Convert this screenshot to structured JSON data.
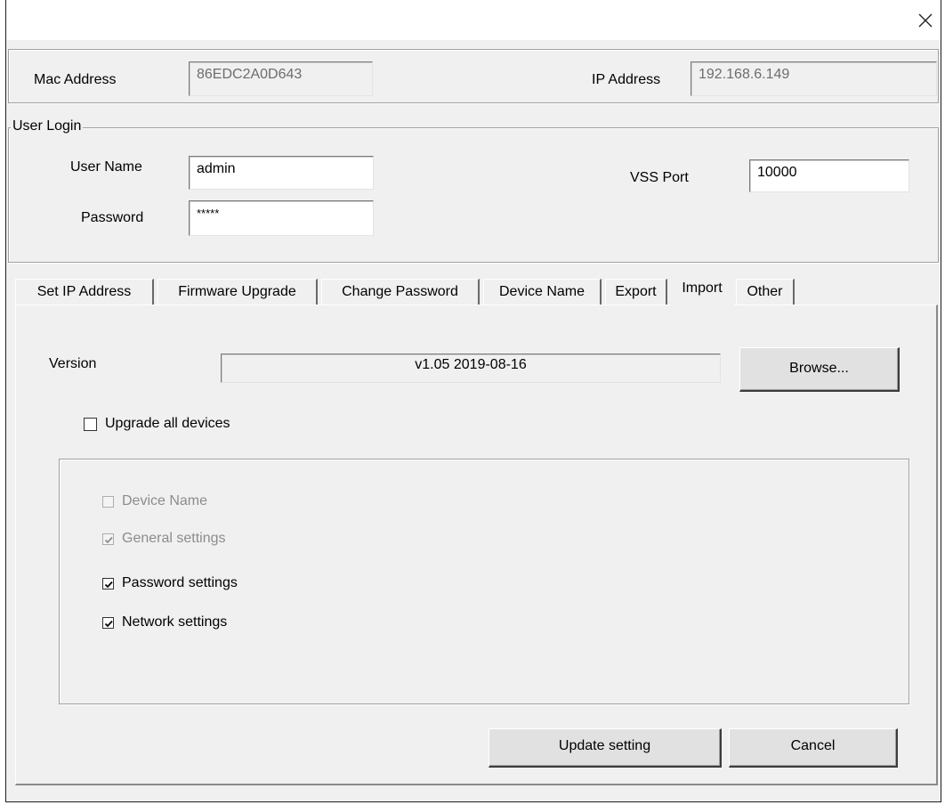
{
  "header": {
    "mac_label": "Mac Address",
    "mac_value": "86EDC2A0D643",
    "ip_label": "IP Address",
    "ip_value": "192.168.6.149"
  },
  "login": {
    "group_title": "User Login",
    "username_label": "User Name",
    "username_value": "admin",
    "password_label": "Password",
    "password_value": "*****",
    "vss_port_label": "VSS Port",
    "vss_port_value": "10000"
  },
  "tabs": [
    {
      "label": "Set IP Address"
    },
    {
      "label": "Firmware Upgrade"
    },
    {
      "label": "Change Password"
    },
    {
      "label": "Device Name"
    },
    {
      "label": "Export"
    },
    {
      "label": "Import",
      "active": true
    },
    {
      "label": "Other"
    }
  ],
  "import_tab": {
    "version_label": "Version",
    "version_value": "v1.05  2019-08-16",
    "browse_label": "Browse...",
    "upgrade_all_label": "Upgrade all devices",
    "upgrade_all_checked": false,
    "options": [
      {
        "label": "Device Name",
        "checked": false,
        "enabled": false
      },
      {
        "label": "General settings",
        "checked": true,
        "enabled": false
      },
      {
        "label": "Password settings",
        "checked": true,
        "enabled": true
      },
      {
        "label": "Network settings",
        "checked": true,
        "enabled": true
      }
    ]
  },
  "footer": {
    "update_label": "Update setting",
    "cancel_label": "Cancel"
  },
  "icons": {
    "close": "close-icon",
    "check": "checkmark-icon"
  }
}
